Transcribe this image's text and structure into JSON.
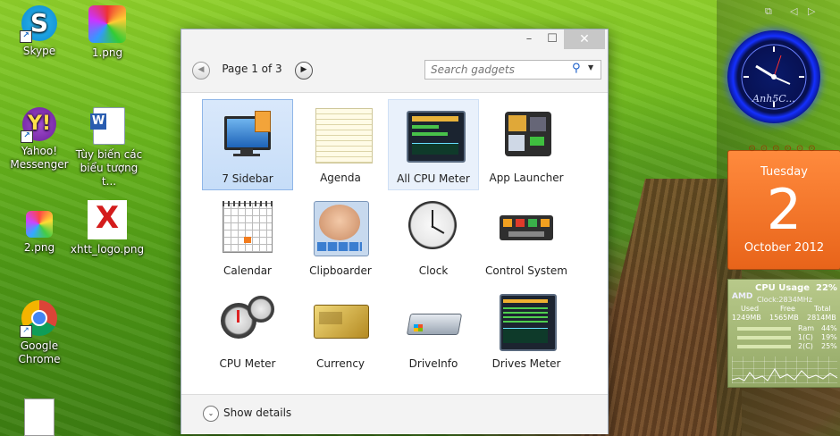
{
  "desktop": {
    "icons": [
      {
        "label": "Skype"
      },
      {
        "label": "1.png"
      },
      {
        "label": "Yahoo! Messenger"
      },
      {
        "label": "Tùy biến các biểu tượng t..."
      },
      {
        "label": "2.png"
      },
      {
        "label": "xhtt_logo.png"
      },
      {
        "label": "Google Chrome"
      }
    ]
  },
  "window": {
    "controls": {
      "minimize": "–",
      "maximize": "☐",
      "close": "✕"
    },
    "pager": {
      "label": "Page 1 of 3",
      "prev": "◀",
      "next": "▶"
    },
    "search": {
      "placeholder": "Search gadgets",
      "icon": "⚲",
      "dropdown": "▼"
    },
    "gadgets": [
      {
        "label": "7 Sidebar",
        "icon": "monitor-icon",
        "selected": true
      },
      {
        "label": "Agenda",
        "icon": "agenda-icon"
      },
      {
        "label": "All CPU Meter",
        "icon": "cpu-usage-icon"
      },
      {
        "label": "App Launcher",
        "icon": "app-launcher-icon"
      },
      {
        "label": "Calendar",
        "icon": "calendar-icon"
      },
      {
        "label": "Clipboarder",
        "icon": "baby-photo-icon"
      },
      {
        "label": "Clock",
        "icon": "clock-icon"
      },
      {
        "label": "Control System",
        "icon": "control-system-icon"
      },
      {
        "label": "CPU Meter",
        "icon": "gauge-icon"
      },
      {
        "label": "Currency",
        "icon": "currency-card-icon"
      },
      {
        "label": "DriveInfo",
        "icon": "drive-icon"
      },
      {
        "label": "Drives Meter",
        "icon": "drives-meter-icon"
      }
    ],
    "footer": {
      "details_label": "Show details",
      "details_icon": "⌄"
    }
  },
  "sidebar": {
    "controls": [
      "⧉",
      "◁",
      "▷"
    ],
    "clock": {
      "brand": "Anh5C..."
    },
    "calendar": {
      "weekday": "Tuesday",
      "day": "2",
      "month": "October 2012"
    },
    "cpu": {
      "title": "CPU Usage",
      "percent": "22%",
      "vendor": "AMD",
      "clock": "Clock:2834MHz",
      "headers": [
        "Used",
        "Free",
        "Total"
      ],
      "mem": [
        "1249MB",
        "1565MB",
        "2814MB"
      ],
      "ram_label": "Ram",
      "ram_pct": "44%",
      "core1_label": "1(C)",
      "core1_pct": "19%",
      "core2_label": "2(C)",
      "core2_pct": "25%"
    }
  }
}
